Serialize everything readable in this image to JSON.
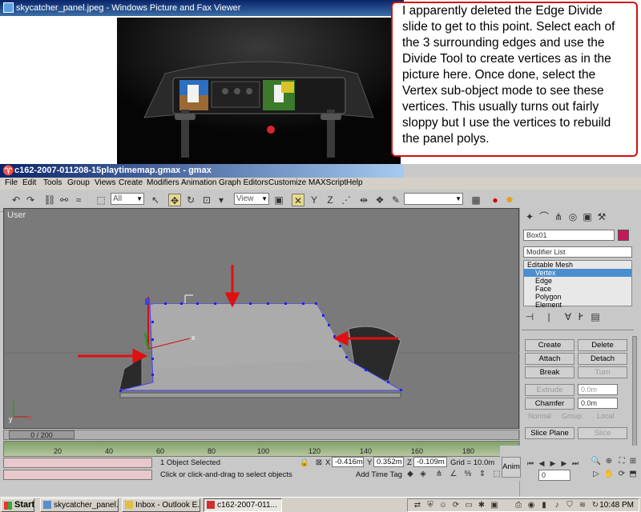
{
  "viewer": {
    "title": "skycatcher_panel.jpeg - Windows Picture and Fax Viewer"
  },
  "note": {
    "text": "I apparently deleted the Edge Divide slide to get to this point.  Select each of the 3 surrounding edges and use the Divide Tool to create vertices as in the picture here.  Once done, select the Vertex sub-object mode to see these vertices.  This usually turns out fairly sloppy but I use the vertices to rebuild the panel polys."
  },
  "gmax": {
    "title": "c162-2007-011208-15playtimemap.gmax - gmax",
    "menu": [
      "File",
      "Edit",
      "Tools",
      "Group",
      "Views",
      "Create",
      "Modifiers",
      "Animation",
      "Graph Editors",
      "Customize",
      "MAXScript",
      "Help"
    ],
    "toolbar": {
      "selection_filter": "All",
      "coord_system": "View"
    },
    "viewport_label": "User",
    "command_panel": {
      "object_name": "Box01",
      "object_color": "#c8185a",
      "modifier_list": "Modifier List",
      "stack": [
        "Editable Mesh",
        "Vertex",
        "Edge",
        "Face",
        "Polygon",
        "Element"
      ],
      "stack_selected": "Vertex",
      "buttons": {
        "create": "Create",
        "delete": "Delete",
        "attach": "Attach",
        "detach": "Detach",
        "break": "Break",
        "turn": "Turn",
        "extrude": "Extrude",
        "extrude_val": "0.0m",
        "chamfer": "Chamfer",
        "chamfer_val": "0.0m",
        "normal": "Normal",
        "group": "Group",
        "local": "Local",
        "slice_plane": "Slice Plane",
        "slice": "Slice"
      }
    },
    "time_slider": "0 / 200",
    "track_ticks": [
      "20",
      "40",
      "60",
      "80",
      "100",
      "120",
      "140",
      "160",
      "180",
      "20"
    ],
    "status": {
      "selection": "1 Object Selected",
      "prompt": "Click or click-and-drag to select objects",
      "x_label": "X",
      "x": "-0.416m",
      "y_label": "Y",
      "y": "0.352m",
      "z_label": "Z",
      "z": "-0.109m",
      "grid": "Grid = 10.0m",
      "add_time_tag": "Add Time Tag",
      "anim": "Anim",
      "frame": "0"
    }
  },
  "taskbar": {
    "start": "Start",
    "tasks": [
      "skycatcher_panel.jp...",
      "Inbox - Outlook E...",
      "c162-2007-011..."
    ],
    "clock": "10:48 PM"
  }
}
